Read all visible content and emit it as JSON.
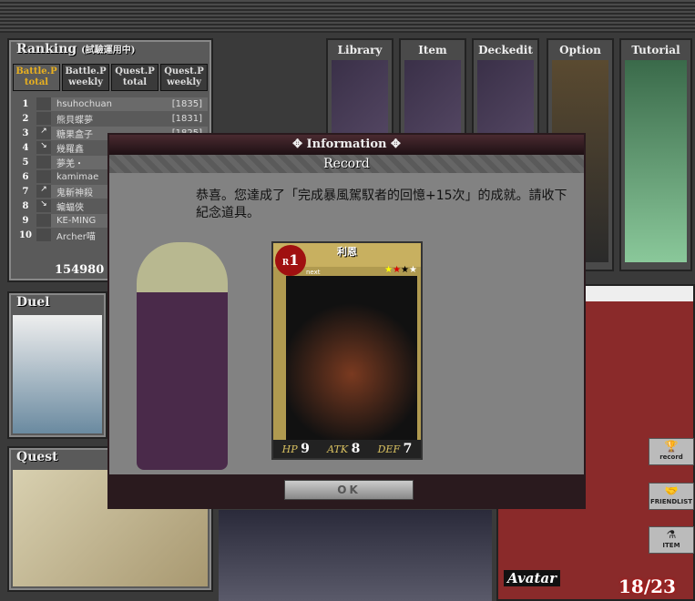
{
  "ranking": {
    "title": "Ranking",
    "subtitle": "(試驗運用中)",
    "tabs": [
      "Battle.P total",
      "Battle.P weekly",
      "Quest.P total",
      "Quest.P weekly"
    ],
    "rows": [
      {
        "rank": "1",
        "trend": "",
        "name": "hsuhochuan",
        "score": "[1835]"
      },
      {
        "rank": "2",
        "trend": "",
        "name": "熊貝蝶夢",
        "score": "[1831]"
      },
      {
        "rank": "3",
        "trend": "↗",
        "name": "糖果盒子",
        "score": "[1825]"
      },
      {
        "rank": "4",
        "trend": "↘",
        "name": "幾羅鑫",
        "score": ""
      },
      {
        "rank": "5",
        "trend": "",
        "name": "夢羌・",
        "score": ""
      },
      {
        "rank": "6",
        "trend": "",
        "name": "kamimae",
        "score": ""
      },
      {
        "rank": "7",
        "trend": "↗",
        "name": "鬼斬神殺",
        "score": ""
      },
      {
        "rank": "8",
        "trend": "↘",
        "name": "蝙蝠俠",
        "score": ""
      },
      {
        "rank": "9",
        "trend": "",
        "name": "KE-MING",
        "score": ""
      },
      {
        "rank": "10",
        "trend": "",
        "name": "Archer喵",
        "score": ""
      }
    ],
    "points": "154980"
  },
  "menu": [
    "Library",
    "Item",
    "Deckedit",
    "Option",
    "Tutorial"
  ],
  "duel": "Duel",
  "quest": "Quest",
  "dialog": {
    "header": "Information",
    "subheader": "Record",
    "message": "恭喜。您達成了「完成暴風駕馭者的回憶+15次」的成就。請收下紀念道具。",
    "ok": "OK",
    "card": {
      "name": "利恩",
      "rarity": "R",
      "level": "1",
      "next": "next",
      "hp": "9",
      "atk": "8",
      "def": "7",
      "hp_label": "HP",
      "atk_label": "ATK",
      "def_label": "DEF"
    }
  },
  "avatar": {
    "label": "Avatar",
    "count": "18/23"
  },
  "side": [
    "record",
    "FRIENDLIST",
    "ITEM"
  ]
}
